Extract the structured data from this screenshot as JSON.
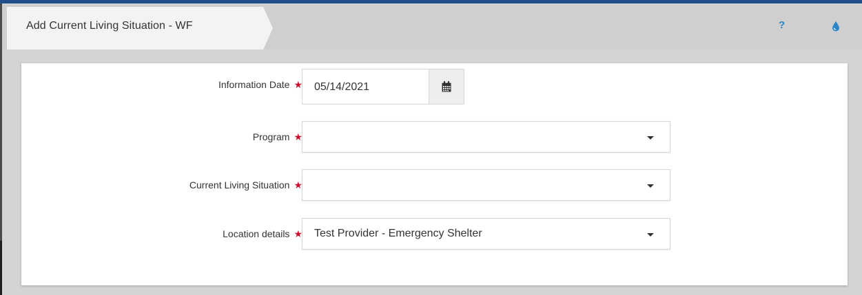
{
  "header": {
    "title": "Add Current Living Situation - WF",
    "help_icon_glyph": "?",
    "help_icon": "question-mark-icon",
    "drop_icon": "droplet-icon",
    "accent": "#2a86c9"
  },
  "form": {
    "required_color": "#c8102e",
    "required_glyph": "★",
    "information_date": {
      "label": "Information Date",
      "value": "05/14/2021",
      "icon": "calendar-icon"
    },
    "program": {
      "label": "Program",
      "value": ""
    },
    "current_living_situation": {
      "label": "Current Living Situation",
      "value": ""
    },
    "location_details": {
      "label": "Location details",
      "value": "Test Provider - Emergency Shelter"
    }
  }
}
